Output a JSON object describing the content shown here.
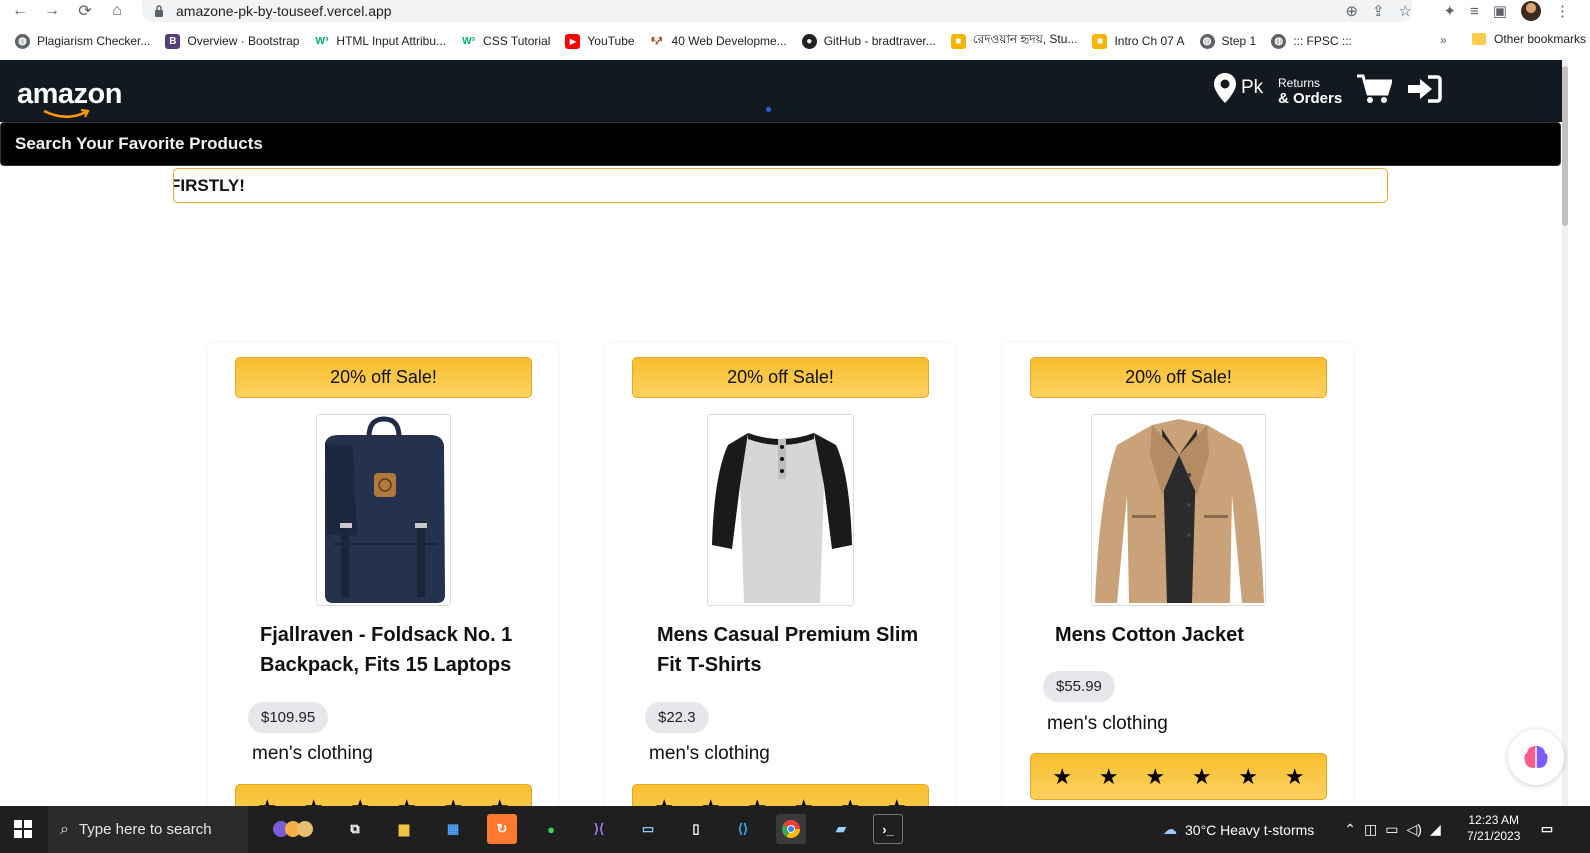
{
  "browser": {
    "url": "amazone-pk-by-touseef.vercel.app",
    "bookmarks": [
      {
        "label": "Plagiarism Checker...",
        "icon": "globe-icon"
      },
      {
        "label": "Overview · Bootstrap",
        "icon": "bootstrap-icon"
      },
      {
        "label": "HTML Input Attribu...",
        "icon": "w3schools-icon"
      },
      {
        "label": "CSS Tutorial",
        "icon": "w3schools-icon"
      },
      {
        "label": "YouTube",
        "icon": "youtube-icon"
      },
      {
        "label": "40 Web Developme...",
        "icon": "dog-icon"
      },
      {
        "label": "GitHub - bradtraver...",
        "icon": "github-icon"
      },
      {
        "label": "রেদওয়ান হৃদয়, Stu...",
        "icon": "bookmark-icon"
      },
      {
        "label": "Intro Ch 07 A",
        "icon": "bookmark-icon"
      },
      {
        "label": "Step 1",
        "icon": "globe-icon"
      },
      {
        "label": "::: FPSC :::",
        "icon": "globe-icon"
      }
    ],
    "more": "»",
    "other_bookmarks": "Other bookmarks"
  },
  "header": {
    "logo": "amazon",
    "location": "Pk",
    "returns_small": "Returns",
    "returns_big": "& Orders"
  },
  "search": {
    "placeholder": "Search Your Favorite Products"
  },
  "marquee": {
    "text": "FIRSTLY!"
  },
  "products": [
    {
      "sale": "20% off Sale!",
      "title": "Fjallraven - Foldsack No. 1 Backpack, Fits 15 Laptops",
      "price": "$109.95",
      "category": "men's clothing",
      "stars": [
        "★",
        "★",
        "★",
        "★",
        "★",
        "★"
      ]
    },
    {
      "sale": "20% off Sale!",
      "title": "Mens Casual Premium Slim Fit T-Shirts",
      "price": "$22.3",
      "category": "men's clothing",
      "stars": [
        "★",
        "★",
        "★",
        "★",
        "★",
        "★"
      ]
    },
    {
      "sale": "20% off Sale!",
      "title": "Mens Cotton Jacket",
      "price": "$55.99",
      "category": "men's clothing",
      "stars": [
        "★",
        "★",
        "★",
        "★",
        "★",
        "★"
      ]
    }
  ],
  "taskbar": {
    "search_placeholder": "Type here to search",
    "weather": "30°C  Heavy t-storms",
    "time": "12:23 AM",
    "date": "7/21/2023"
  },
  "colors": {
    "header_bg": "#131921",
    "sale_yellow": "#f8bf2e",
    "marquee_border": "#f2a73b"
  }
}
